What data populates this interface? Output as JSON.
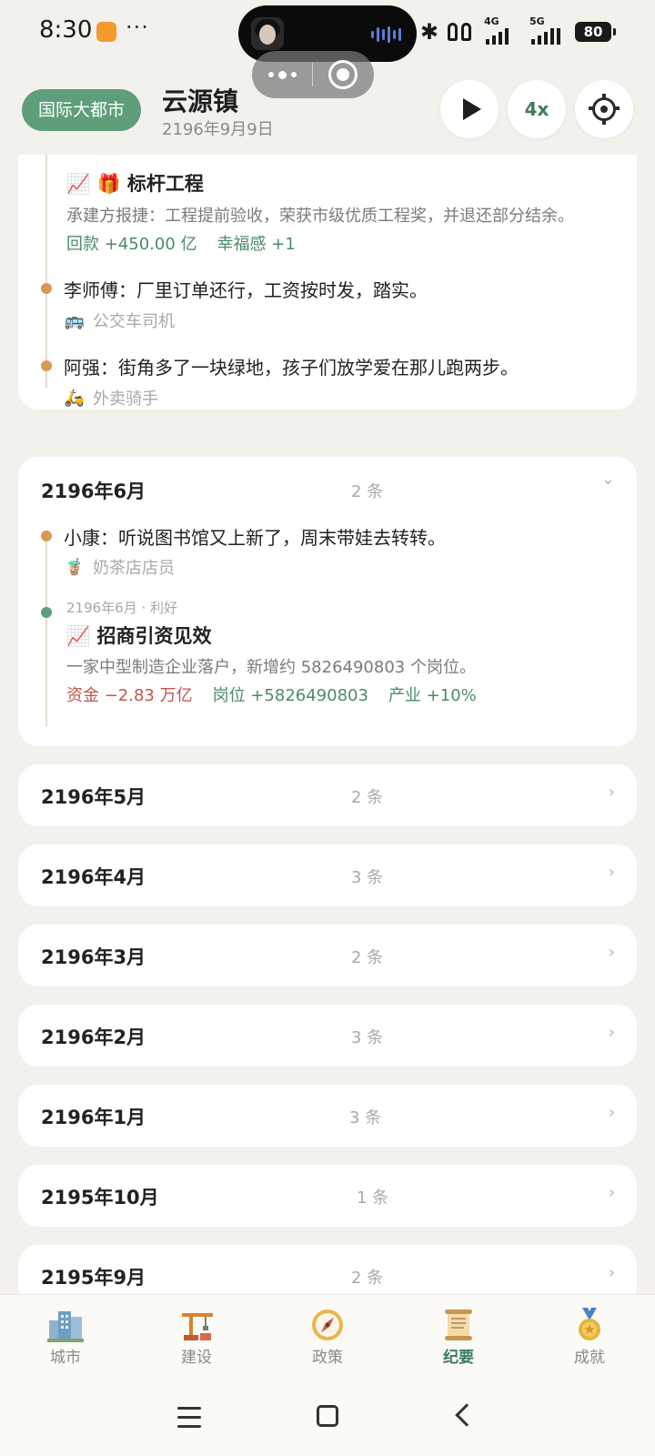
{
  "status_bar": {
    "time": "8:30",
    "more": "···",
    "net_4g": "4G",
    "net_5g": "5G",
    "battery": "80"
  },
  "header": {
    "level_badge": "国际大都市",
    "city_name": "云源镇",
    "date": "2196年9月9日",
    "speed": "4x"
  },
  "top_card": {
    "event": {
      "title": "标杆工程",
      "title_icons": "📈 🎁",
      "description": "承建方报捷：工程提前验收，荣获市级优质工程奖，并退还部分结余。",
      "effects": [
        "回款 +450.00 亿",
        "幸福感 +1"
      ]
    },
    "quotes": [
      {
        "text": "李师傅：厂里订单还行，工资按时发，踏实。",
        "role": "公交车司机",
        "role_icon": "🚌"
      },
      {
        "text": "阿强：街角多了一块绿地，孩子们放学爱在那儿跑两步。",
        "role": "外卖骑手",
        "role_icon": "🛵"
      }
    ]
  },
  "june_card": {
    "month": "2196年6月",
    "count": "2 条",
    "arrow": "⌄",
    "quote": {
      "text": "小康：听说图书馆又上新了，周末带娃去转转。",
      "role": "奶茶店店员",
      "role_icon": "🧋"
    },
    "event": {
      "meta": "2196年6月 · 利好",
      "title": "招商引资见效",
      "title_icon": "📈",
      "description": "一家中型制造企业落户，新增约 5826490803 个岗位。",
      "effects": [
        {
          "text": "资金 −2.83 万亿",
          "tone": "negative"
        },
        {
          "text": "岗位 +5826490803",
          "tone": "positive"
        },
        {
          "text": "产业 +10%",
          "tone": "positive"
        }
      ]
    }
  },
  "collapsed_months": [
    {
      "month": "2196年5月",
      "count": "2 条",
      "arrow": "›"
    },
    {
      "month": "2196年4月",
      "count": "3 条",
      "arrow": "›"
    },
    {
      "month": "2196年3月",
      "count": "2 条",
      "arrow": "›"
    },
    {
      "month": "2196年2月",
      "count": "3 条",
      "arrow": "›"
    },
    {
      "month": "2196年1月",
      "count": "3 条",
      "arrow": "›"
    },
    {
      "month": "2195年10月",
      "count": "1 条",
      "arrow": "›"
    },
    {
      "month": "2195年9月",
      "count": "2 条",
      "arrow": "›"
    }
  ],
  "bottom_nav": {
    "items": [
      {
        "label": "城市",
        "icon": "city-icon"
      },
      {
        "label": "建设",
        "icon": "crane-icon"
      },
      {
        "label": "政策",
        "icon": "compass-icon"
      },
      {
        "label": "纪要",
        "icon": "scroll-icon",
        "active": true
      },
      {
        "label": "成就",
        "icon": "medal-icon"
      }
    ]
  },
  "colors": {
    "accent_green": "#5e9e7b",
    "positive": "#4b8b68",
    "negative": "#c0554a",
    "timeline_orange": "#d59a55",
    "background": "#f3f1ec"
  }
}
